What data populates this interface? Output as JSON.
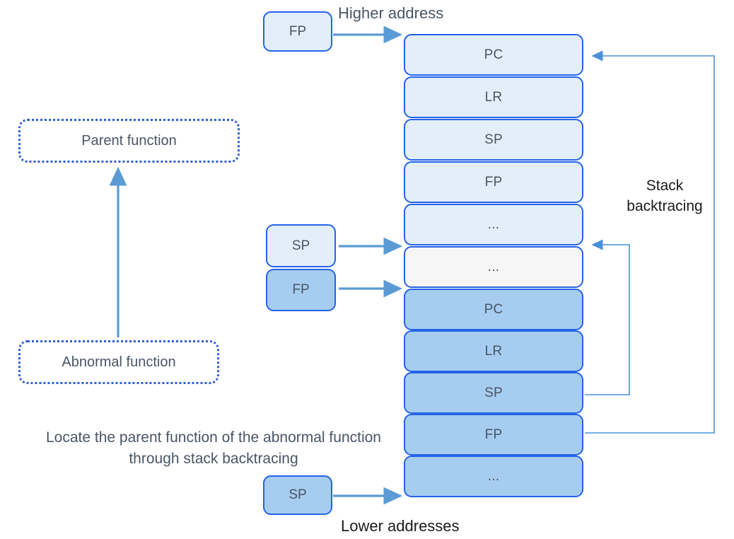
{
  "diagram": {
    "title_labels": {
      "higher_address": "Higher address",
      "lower_addresses": "Lower addresses",
      "stack_backtracing": "Stack backtracing",
      "caption": "Locate the parent function of the abnormal function through stack backtracing"
    },
    "function_boxes": [
      {
        "id": "parent-function",
        "label": "Parent function"
      },
      {
        "id": "abnormal-function",
        "label": "Abnormal function"
      }
    ],
    "registers": [
      {
        "id": "fp-top",
        "label": "FP",
        "shade": "light"
      },
      {
        "id": "sp-middle",
        "label": "SP",
        "shade": "light"
      },
      {
        "id": "fp-middle",
        "label": "FP",
        "shade": "dark"
      },
      {
        "id": "sp-bottom",
        "label": "SP",
        "shade": "dark"
      }
    ],
    "stack_cells": [
      {
        "index": 0,
        "label": "PC",
        "shade": "light"
      },
      {
        "index": 1,
        "label": "LR",
        "shade": "light"
      },
      {
        "index": 2,
        "label": "SP",
        "shade": "light"
      },
      {
        "index": 3,
        "label": "FP",
        "shade": "light"
      },
      {
        "index": 4,
        "label": "...",
        "shade": "light"
      },
      {
        "index": 5,
        "label": "...",
        "shade": "gray"
      },
      {
        "index": 6,
        "label": "PC",
        "shade": "dark"
      },
      {
        "index": 7,
        "label": "LR",
        "shade": "dark"
      },
      {
        "index": 8,
        "label": "SP",
        "shade": "dark"
      },
      {
        "index": 9,
        "label": "FP",
        "shade": "dark"
      },
      {
        "index": 10,
        "label": "...",
        "shade": "dark"
      }
    ],
    "colors": {
      "cell_light": "#e2effb",
      "cell_dark": "#a6cdf0",
      "cell_gray": "#f7f6f6",
      "border_blue": "#2563e8",
      "arrow_blue": "#5b9bd5",
      "thin_arrow_blue": "#4a90d9",
      "text_gray": "#4a5566",
      "text_black": "#1b1b1b",
      "dotted_border": "#2f5fd8"
    }
  }
}
